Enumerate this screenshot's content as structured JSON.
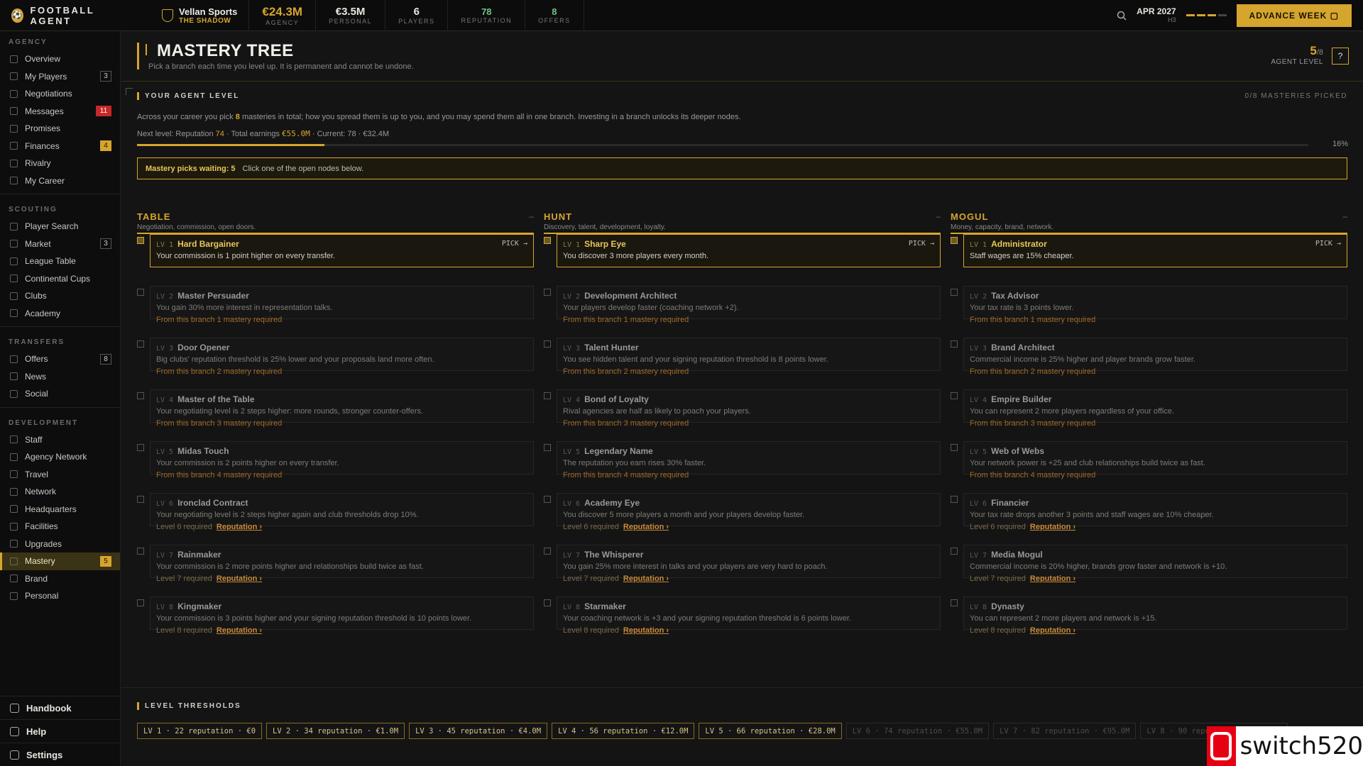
{
  "topbar": {
    "brand": "FOOTBALL AGENT",
    "club_name": "Vellan Sports",
    "club_sub": "THE SHADOW",
    "stats": [
      {
        "value": "€24.3M",
        "label": "AGENCY"
      },
      {
        "value": "€3.5M",
        "label": "PERSONAL"
      },
      {
        "value": "6",
        "label": "PLAYERS"
      },
      {
        "value": "78",
        "label": "REPUTATION"
      },
      {
        "value": "8",
        "label": "OFFERS"
      }
    ],
    "date": "APR 2027",
    "date_sub": "H3",
    "advance_label": "ADVANCE WEEK",
    "icons": {
      "search": "search-icon",
      "logo": "football-icon",
      "club": "shield-icon"
    }
  },
  "sidebar": {
    "sections": [
      {
        "title": "AGENCY",
        "items": [
          {
            "label": "Overview",
            "badge": ""
          },
          {
            "label": "My Players",
            "badge": "3"
          },
          {
            "label": "Negotiations",
            "badge": ""
          },
          {
            "label": "Messages",
            "badge": "11"
          },
          {
            "label": "Promises",
            "badge": ""
          },
          {
            "label": "Finances",
            "badge": "4"
          },
          {
            "label": "Rivalry",
            "badge": ""
          },
          {
            "label": "My Career",
            "badge": ""
          }
        ]
      },
      {
        "title": "SCOUTING",
        "items": [
          {
            "label": "Player Search",
            "badge": ""
          },
          {
            "label": "Market",
            "badge": "3"
          },
          {
            "label": "League Table",
            "badge": ""
          },
          {
            "label": "Continental Cups",
            "badge": ""
          },
          {
            "label": "Clubs",
            "badge": ""
          },
          {
            "label": "Academy",
            "badge": ""
          }
        ]
      },
      {
        "title": "TRANSFERS",
        "items": [
          {
            "label": "Offers",
            "badge": "8"
          },
          {
            "label": "News",
            "badge": ""
          },
          {
            "label": "Social",
            "badge": ""
          }
        ]
      },
      {
        "title": "DEVELOPMENT",
        "items": [
          {
            "label": "Staff",
            "badge": ""
          },
          {
            "label": "Agency Network",
            "badge": ""
          },
          {
            "label": "Travel",
            "badge": ""
          },
          {
            "label": "Network",
            "badge": ""
          },
          {
            "label": "Headquarters",
            "badge": ""
          },
          {
            "label": "Facilities",
            "badge": ""
          },
          {
            "label": "Upgrades",
            "badge": ""
          },
          {
            "label": "Mastery",
            "badge": "5"
          },
          {
            "label": "Brand",
            "badge": ""
          },
          {
            "label": "Personal",
            "badge": ""
          }
        ]
      }
    ],
    "bottom": [
      "Handbook",
      "Help",
      "Settings"
    ]
  },
  "page": {
    "title": "MASTERY TREE",
    "subtitle": "Pick a branch each time you level up. It is permanent and cannot be undone.",
    "agent_level_value": "5",
    "agent_level_max": "/8",
    "agent_level_label": "AGENT LEVEL",
    "help_label": "?"
  },
  "level": {
    "header": "YOUR AGENT LEVEL",
    "picked": "0/8 MASTERIES PICKED",
    "desc_pre": "Across your career you pick ",
    "desc_count": "8",
    "desc_post": " masteries in total; how you spread them is up to you, and you may spend them all in one branch. Investing in a branch unlocks its deeper nodes.",
    "next_pre": "Next level: Reputation ",
    "next_rep": "74",
    "next_mid": " · Total earnings ",
    "next_earn": "€55.0M",
    "next_post": " · Current: 78 · €32.4M",
    "progress_pct": 16,
    "progress_label": "16%",
    "waiting_bold": "Mastery picks waiting: 5",
    "waiting_text": "Click one of the open nodes below."
  },
  "branches": [
    {
      "title": "TABLE",
      "desc": "Negotiation, commission, open doors.",
      "dash": "–",
      "nodes": [
        {
          "lv": "LV 1",
          "name": "Hard Bargainer",
          "desc": "Your commission is 1 point higher on every transfer.",
          "req": "",
          "link": "",
          "pick": "PICK →"
        },
        {
          "lv": "LV 2",
          "name": "Master Persuader",
          "desc": "You gain 30% more interest in representation talks.",
          "req": "From this branch 1 mastery required",
          "link": "",
          "pick": ""
        },
        {
          "lv": "LV 3",
          "name": "Door Opener",
          "desc": "Big clubs' reputation threshold is 25% lower and your proposals land more often.",
          "req": "From this branch 2 mastery required",
          "link": "",
          "pick": ""
        },
        {
          "lv": "LV 4",
          "name": "Master of the Table",
          "desc": "Your negotiating level is 2 steps higher: more rounds, stronger counter-offers.",
          "req": "From this branch 3 mastery required",
          "link": "",
          "pick": ""
        },
        {
          "lv": "LV 5",
          "name": "Midas Touch",
          "desc": "Your commission is 2 points higher on every transfer.",
          "req": "From this branch 4 mastery required",
          "link": "",
          "pick": ""
        },
        {
          "lv": "LV 6",
          "name": "Ironclad Contract",
          "desc": "Your negotiating level is 2 steps higher again and club thresholds drop 10%.",
          "req": "Level 6 required",
          "link": "Reputation ›",
          "pick": ""
        },
        {
          "lv": "LV 7",
          "name": "Rainmaker",
          "desc": "Your commission is 2 more points higher and relationships build twice as fast.",
          "req": "Level 7 required",
          "link": "Reputation ›",
          "pick": ""
        },
        {
          "lv": "LV 8",
          "name": "Kingmaker",
          "desc": "Your commission is 3 points higher and your signing reputation threshold is 10 points lower.",
          "req": "Level 8 required",
          "link": "Reputation ›",
          "pick": ""
        }
      ]
    },
    {
      "title": "HUNT",
      "desc": "Discovery, talent, development, loyalty.",
      "dash": "–",
      "nodes": [
        {
          "lv": "LV 1",
          "name": "Sharp Eye",
          "desc": "You discover 3 more players every month.",
          "req": "",
          "link": "",
          "pick": "PICK →"
        },
        {
          "lv": "LV 2",
          "name": "Development Architect",
          "desc": "Your players develop faster (coaching network +2).",
          "req": "From this branch 1 mastery required",
          "link": "",
          "pick": ""
        },
        {
          "lv": "LV 3",
          "name": "Talent Hunter",
          "desc": "You see hidden talent and your signing reputation threshold is 8 points lower.",
          "req": "From this branch 2 mastery required",
          "link": "",
          "pick": ""
        },
        {
          "lv": "LV 4",
          "name": "Bond of Loyalty",
          "desc": "Rival agencies are half as likely to poach your players.",
          "req": "From this branch 3 mastery required",
          "link": "",
          "pick": ""
        },
        {
          "lv": "LV 5",
          "name": "Legendary Name",
          "desc": "The reputation you earn rises 30% faster.",
          "req": "From this branch 4 mastery required",
          "link": "",
          "pick": ""
        },
        {
          "lv": "LV 6",
          "name": "Academy Eye",
          "desc": "You discover 5 more players a month and your players develop faster.",
          "req": "Level 6 required",
          "link": "Reputation ›",
          "pick": ""
        },
        {
          "lv": "LV 7",
          "name": "The Whisperer",
          "desc": "You gain 25% more interest in talks and your players are very hard to poach.",
          "req": "Level 7 required",
          "link": "Reputation ›",
          "pick": ""
        },
        {
          "lv": "LV 8",
          "name": "Starmaker",
          "desc": "Your coaching network is +3 and your signing reputation threshold is 6 points lower.",
          "req": "Level 8 required",
          "link": "Reputation ›",
          "pick": ""
        }
      ]
    },
    {
      "title": "MOGUL",
      "desc": "Money, capacity, brand, network.",
      "dash": "–",
      "nodes": [
        {
          "lv": "LV 1",
          "name": "Administrator",
          "desc": "Staff wages are 15% cheaper.",
          "req": "",
          "link": "",
          "pick": "PICK →"
        },
        {
          "lv": "LV 2",
          "name": "Tax Advisor",
          "desc": "Your tax rate is 3 points lower.",
          "req": "From this branch 1 mastery required",
          "link": "",
          "pick": ""
        },
        {
          "lv": "LV 3",
          "name": "Brand Architect",
          "desc": "Commercial income is 25% higher and player brands grow faster.",
          "req": "From this branch 2 mastery required",
          "link": "",
          "pick": ""
        },
        {
          "lv": "LV 4",
          "name": "Empire Builder",
          "desc": "You can represent 2 more players regardless of your office.",
          "req": "From this branch 3 mastery required",
          "link": "",
          "pick": ""
        },
        {
          "lv": "LV 5",
          "name": "Web of Webs",
          "desc": "Your network power is +25 and club relationships build twice as fast.",
          "req": "From this branch 4 mastery required",
          "link": "",
          "pick": ""
        },
        {
          "lv": "LV 6",
          "name": "Financier",
          "desc": "Your tax rate drops another 3 points and staff wages are 10% cheaper.",
          "req": "Level 6 required",
          "link": "Reputation ›",
          "pick": ""
        },
        {
          "lv": "LV 7",
          "name": "Media Mogul",
          "desc": "Commercial income is 20% higher, brands grow faster and network is +10.",
          "req": "Level 7 required",
          "link": "Reputation ›",
          "pick": ""
        },
        {
          "lv": "LV 8",
          "name": "Dynasty",
          "desc": "You can represent 2 more players and network is +15.",
          "req": "Level 8 required",
          "link": "Reputation ›",
          "pick": ""
        }
      ]
    }
  ],
  "thresholds": {
    "header": "LEVEL THRESHOLDS",
    "items": [
      {
        "label": "LV 1 · 22 reputation · €0",
        "reached": true
      },
      {
        "label": "LV 2 · 34 reputation · €1.0M",
        "reached": true
      },
      {
        "label": "LV 3 · 45 reputation · €4.0M",
        "reached": true
      },
      {
        "label": "LV 4 · 56 reputation · €12.0M",
        "reached": true
      },
      {
        "label": "LV 5 · 66 reputation · €28.0M",
        "reached": true
      },
      {
        "label": "LV 6 · 74 reputation · €55.0M",
        "reached": false
      },
      {
        "label": "LV 7 · 82 reputation · €95.0M",
        "reached": false
      },
      {
        "label": "LV 8 · 90 reputation · €160.0M",
        "reached": false
      }
    ]
  },
  "watermark": {
    "text": "switch520"
  },
  "colors": {
    "accent": "#d6a52e",
    "badge_red": "#c62828",
    "positive": "#6fc48a"
  }
}
